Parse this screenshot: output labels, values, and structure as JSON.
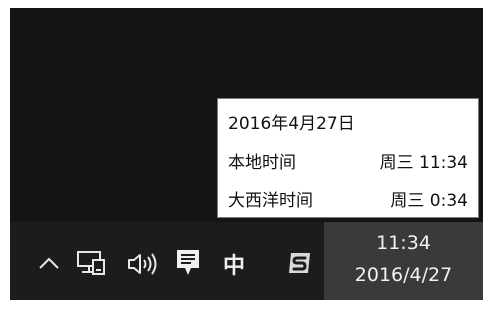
{
  "tooltip": {
    "date": "2016年4月27日",
    "clocks": [
      {
        "name": "本地时间",
        "time": "周三 11:34"
      },
      {
        "name": "大西洋时间",
        "time": "周三 0:34"
      }
    ]
  },
  "taskbar": {
    "tray_icons": [
      "chevron-up-icon",
      "network-icon",
      "volume-icon",
      "action-center-icon",
      "ime-indicator",
      "sogou-icon"
    ],
    "ime_label": "中",
    "clock": {
      "time": "11:34",
      "date": "2016/4/27"
    }
  },
  "colors": {
    "desktop": "#141414",
    "taskbar": "#1c1c1c",
    "clock_highlight": "#3a3a3a",
    "tooltip_bg": "#ffffff"
  }
}
